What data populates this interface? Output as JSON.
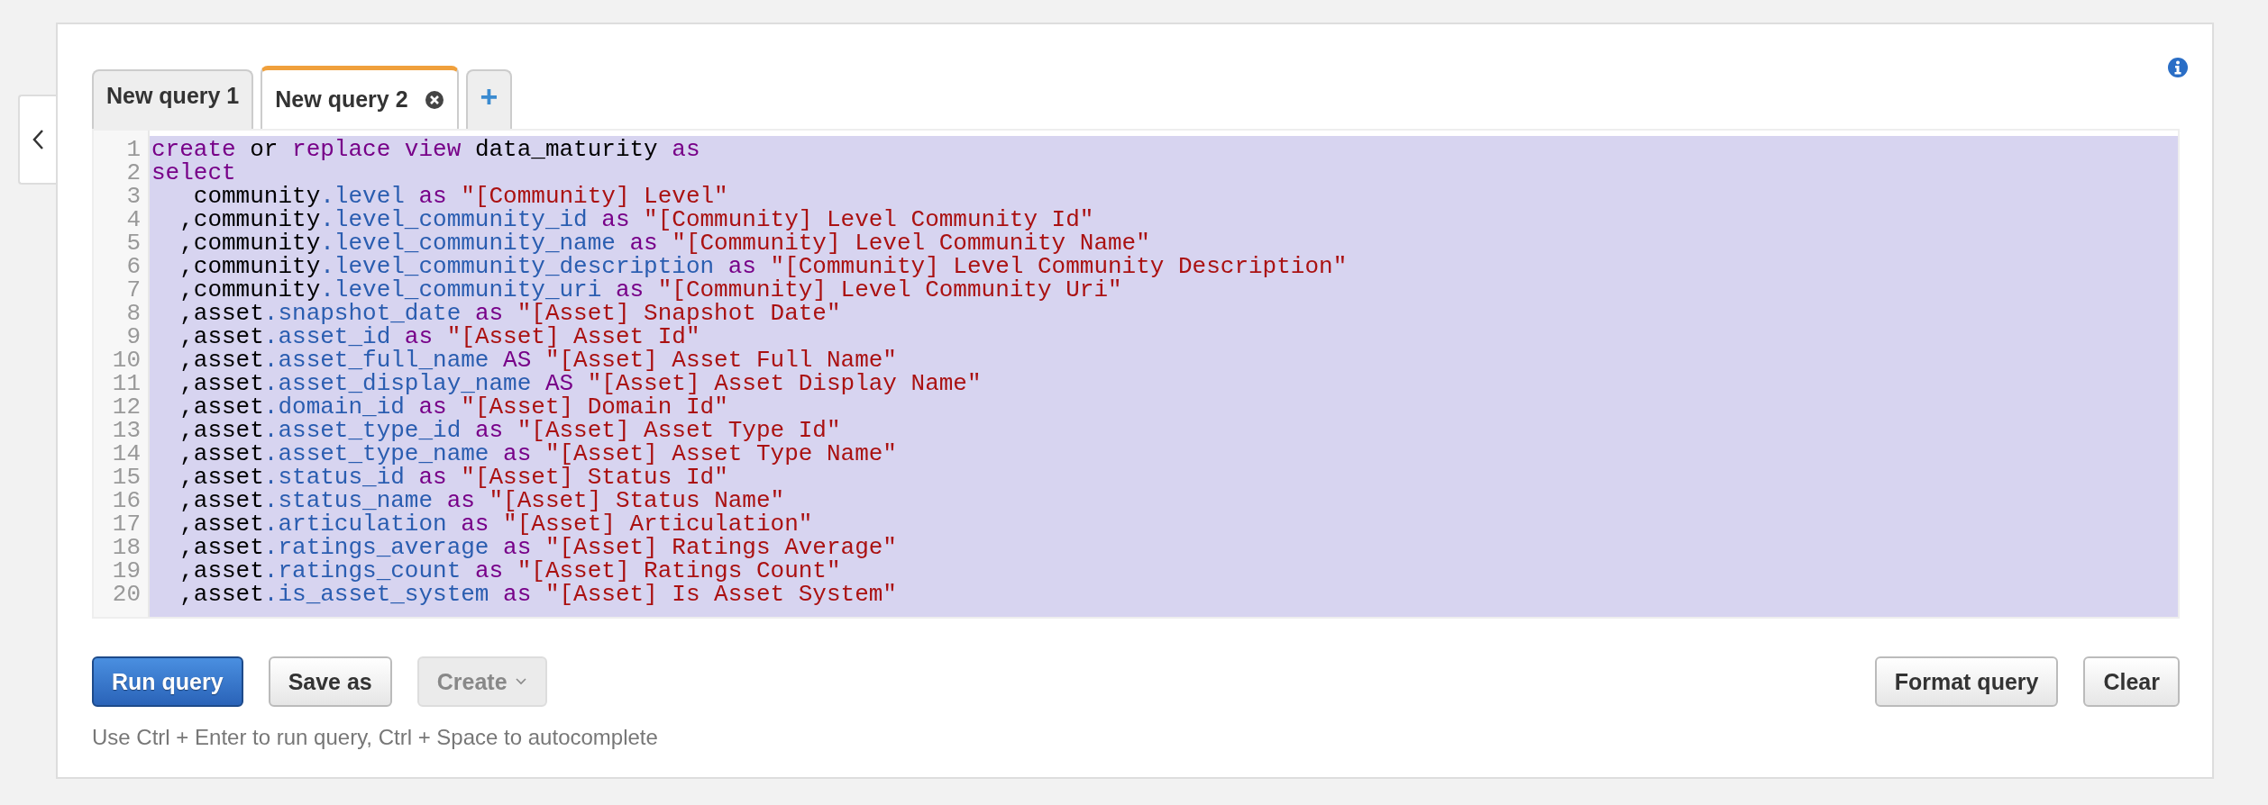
{
  "tabs": [
    {
      "label": "New query 1",
      "selected": false,
      "closable": false
    },
    {
      "label": "New query 2",
      "selected": true,
      "closable": true
    }
  ],
  "add_tab": "+",
  "editor": {
    "selected": true,
    "lines": [
      {
        "number": "1",
        "tokens": [
          {
            "kind": "keyword",
            "text": "create"
          },
          {
            "kind": "plain",
            "text": " or "
          },
          {
            "kind": "keyword",
            "text": "replace view"
          },
          {
            "kind": "plain",
            "text": " data_maturity "
          },
          {
            "kind": "keyword",
            "text": "as"
          }
        ]
      },
      {
        "number": "2",
        "tokens": [
          {
            "kind": "keyword",
            "text": "select"
          }
        ]
      },
      {
        "number": "3",
        "tokens": [
          {
            "kind": "plain",
            "text": "   community"
          },
          {
            "kind": "property",
            "text": ".level "
          },
          {
            "kind": "keyword",
            "text": "as "
          },
          {
            "kind": "string",
            "text": "\"[Community] Level\""
          }
        ]
      },
      {
        "number": "4",
        "tokens": [
          {
            "kind": "plain",
            "text": "  ,community"
          },
          {
            "kind": "property",
            "text": ".level_community_id "
          },
          {
            "kind": "keyword",
            "text": "as "
          },
          {
            "kind": "string",
            "text": "\"[Community] Level Community Id\""
          }
        ]
      },
      {
        "number": "5",
        "tokens": [
          {
            "kind": "plain",
            "text": "  ,community"
          },
          {
            "kind": "property",
            "text": ".level_community_name "
          },
          {
            "kind": "keyword",
            "text": "as "
          },
          {
            "kind": "string",
            "text": "\"[Community] Level Community Name\""
          }
        ]
      },
      {
        "number": "6",
        "tokens": [
          {
            "kind": "plain",
            "text": "  ,community"
          },
          {
            "kind": "property",
            "text": ".level_community_description "
          },
          {
            "kind": "keyword",
            "text": "as "
          },
          {
            "kind": "string",
            "text": "\"[Community] Level Community Description\""
          }
        ]
      },
      {
        "number": "7",
        "tokens": [
          {
            "kind": "plain",
            "text": "  ,community"
          },
          {
            "kind": "property",
            "text": ".level_community_uri "
          },
          {
            "kind": "keyword",
            "text": "as "
          },
          {
            "kind": "string",
            "text": "\"[Community] Level Community Uri\""
          }
        ]
      },
      {
        "number": "8",
        "tokens": [
          {
            "kind": "plain",
            "text": "  ,asset"
          },
          {
            "kind": "property",
            "text": ".snapshot_date "
          },
          {
            "kind": "keyword",
            "text": "as "
          },
          {
            "kind": "string",
            "text": "\"[Asset] Snapshot Date\""
          }
        ]
      },
      {
        "number": "9",
        "tokens": [
          {
            "kind": "plain",
            "text": "  ,asset"
          },
          {
            "kind": "property",
            "text": ".asset_id "
          },
          {
            "kind": "keyword",
            "text": "as "
          },
          {
            "kind": "string",
            "text": "\"[Asset] Asset Id\""
          }
        ]
      },
      {
        "number": "10",
        "tokens": [
          {
            "kind": "plain",
            "text": "  ,asset"
          },
          {
            "kind": "property",
            "text": ".asset_full_name "
          },
          {
            "kind": "keyword",
            "text": "AS "
          },
          {
            "kind": "string",
            "text": "\"[Asset] Asset Full Name\""
          }
        ]
      },
      {
        "number": "11",
        "tokens": [
          {
            "kind": "plain",
            "text": "  ,asset"
          },
          {
            "kind": "property",
            "text": ".asset_display_name "
          },
          {
            "kind": "keyword",
            "text": "AS "
          },
          {
            "kind": "string",
            "text": "\"[Asset] Asset Display Name\""
          }
        ]
      },
      {
        "number": "12",
        "tokens": [
          {
            "kind": "plain",
            "text": "  ,asset"
          },
          {
            "kind": "property",
            "text": ".domain_id "
          },
          {
            "kind": "keyword",
            "text": "as "
          },
          {
            "kind": "string",
            "text": "\"[Asset] Domain Id\""
          }
        ]
      },
      {
        "number": "13",
        "tokens": [
          {
            "kind": "plain",
            "text": "  ,asset"
          },
          {
            "kind": "property",
            "text": ".asset_type_id "
          },
          {
            "kind": "keyword",
            "text": "as "
          },
          {
            "kind": "string",
            "text": "\"[Asset] Asset Type Id\""
          }
        ]
      },
      {
        "number": "14",
        "tokens": [
          {
            "kind": "plain",
            "text": "  ,asset"
          },
          {
            "kind": "property",
            "text": ".asset_type_name "
          },
          {
            "kind": "keyword",
            "text": "as "
          },
          {
            "kind": "string",
            "text": "\"[Asset] Asset Type Name\""
          }
        ]
      },
      {
        "number": "15",
        "tokens": [
          {
            "kind": "plain",
            "text": "  ,asset"
          },
          {
            "kind": "property",
            "text": ".status_id "
          },
          {
            "kind": "keyword",
            "text": "as "
          },
          {
            "kind": "string",
            "text": "\"[Asset] Status Id\""
          }
        ]
      },
      {
        "number": "16",
        "tokens": [
          {
            "kind": "plain",
            "text": "  ,asset"
          },
          {
            "kind": "property",
            "text": ".status_name "
          },
          {
            "kind": "keyword",
            "text": "as "
          },
          {
            "kind": "string",
            "text": "\"[Asset] Status Name\""
          }
        ]
      },
      {
        "number": "17",
        "tokens": [
          {
            "kind": "plain",
            "text": "  ,asset"
          },
          {
            "kind": "property",
            "text": ".articulation "
          },
          {
            "kind": "keyword",
            "text": "as "
          },
          {
            "kind": "string",
            "text": "\"[Asset] Articulation\""
          }
        ]
      },
      {
        "number": "18",
        "tokens": [
          {
            "kind": "plain",
            "text": "  ,asset"
          },
          {
            "kind": "property",
            "text": ".ratings_average "
          },
          {
            "kind": "keyword",
            "text": "as "
          },
          {
            "kind": "string",
            "text": "\"[Asset] Ratings Average\""
          }
        ]
      },
      {
        "number": "19",
        "tokens": [
          {
            "kind": "plain",
            "text": "  ,asset"
          },
          {
            "kind": "property",
            "text": ".ratings_count "
          },
          {
            "kind": "keyword",
            "text": "as "
          },
          {
            "kind": "string",
            "text": "\"[Asset] Ratings Count\""
          }
        ]
      },
      {
        "number": "20",
        "tokens": [
          {
            "kind": "plain",
            "text": "  ,asset"
          },
          {
            "kind": "property",
            "text": ".is_asset_system "
          },
          {
            "kind": "keyword",
            "text": "as "
          },
          {
            "kind": "string",
            "text": "\"[Asset] Is Asset System\""
          }
        ]
      }
    ]
  },
  "buttons_left": [
    {
      "label": "Run query",
      "kind": "primary",
      "disabled": false,
      "dropdown": false
    },
    {
      "label": "Save as",
      "kind": "normal",
      "disabled": false,
      "dropdown": false
    },
    {
      "label": "Create",
      "kind": "normal",
      "disabled": true,
      "dropdown": true
    }
  ],
  "buttons_right": [
    {
      "label": "Format query",
      "disabled": false
    },
    {
      "label": "Clear",
      "disabled": false
    }
  ],
  "hint": "Use Ctrl + Enter to run query, Ctrl + Space to autocomplete"
}
